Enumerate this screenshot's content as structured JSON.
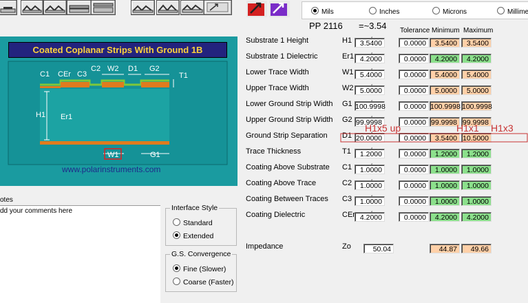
{
  "units": {
    "options": [
      {
        "label": "Mils",
        "selected": true
      },
      {
        "label": "Inches",
        "selected": false
      },
      {
        "label": "Microns",
        "selected": false
      },
      {
        "label": "Millime",
        "selected": false
      }
    ]
  },
  "diagram": {
    "title": "Coated Coplanar Strips With Ground 1B",
    "labels": {
      "c1": "C1",
      "cer": "CEr",
      "c3": "C3",
      "c2": "C2",
      "w2": "W2",
      "d1": "D1",
      "g2": "G2",
      "t1": "T1",
      "h1": "H1",
      "er1": "Er1",
      "w1": "W1",
      "g1": "G1"
    },
    "url": "www.polarinstruments.com",
    "colors": {
      "background": "#1a9ba0",
      "title_bg": "#23237e",
      "title_fg": "#ffd23c"
    }
  },
  "stack_label": "PP 2116",
  "stack_value": "=~3.54",
  "columns": {
    "tolerance": "Tolerance",
    "minimum": "Minimum",
    "maximum": "Maximum"
  },
  "params": [
    {
      "label": "Substrate 1 Height",
      "sym": "H1",
      "pm": "+/-",
      "val": "3.5400",
      "tol": "0.0000",
      "min": "3.5400",
      "max": "3.5400",
      "shade": "orange"
    },
    {
      "label": "Substrate 1 Dielectric",
      "sym": "Er1",
      "pm": "+/-",
      "val": "4.2000",
      "tol": "0.0000",
      "min": "4.2000",
      "max": "4.2000",
      "shade": "green"
    },
    {
      "label": "Lower Trace Width",
      "sym": "W1",
      "pm": "+/-",
      "val": "5.4000",
      "tol": "0.0000",
      "min": "5.4000",
      "max": "5.4000",
      "shade": "orange"
    },
    {
      "label": "Upper Trace Width",
      "sym": "W2",
      "pm": "+/-",
      "val": "5.0000",
      "tol": "0.0000",
      "min": "5.0000",
      "max": "5.0000",
      "shade": "orange"
    },
    {
      "label": "Lower Ground Strip Width",
      "sym": "G1",
      "pm": "+/-",
      "val": "100.9998",
      "tol": "0.0000",
      "min": "100.9998",
      "max": "100.9998",
      "shade": "orange"
    },
    {
      "label": "Upper Ground Strip Width",
      "sym": "G2",
      "pm": "+/-",
      "val": "99.9998",
      "tol": "0.0000",
      "min": "99.9998",
      "max": "99.9998",
      "shade": "orange"
    },
    {
      "label": "Ground Strip Separation",
      "sym": "D1",
      "pm": "+/-",
      "val": "20.0000",
      "tol": "0.0000",
      "min": "3.5400",
      "max": "10.5000",
      "shade": "orange"
    },
    {
      "label": "Trace Thickness",
      "sym": "T1",
      "pm": "+/-",
      "val": "1.2000",
      "tol": "0.0000",
      "min": "1.2000",
      "max": "1.2000",
      "shade": "green"
    },
    {
      "label": "Coating Above Substrate",
      "sym": "C1",
      "pm": "+/-",
      "val": "1.0000",
      "tol": "0.0000",
      "min": "1.0000",
      "max": "1.0000",
      "shade": "green"
    },
    {
      "label": "Coating Above Trace",
      "sym": "C2",
      "pm": "+/-",
      "val": "1.0000",
      "tol": "0.0000",
      "min": "1.0000",
      "max": "1.0000",
      "shade": "green"
    },
    {
      "label": "Coating Between Traces",
      "sym": "C3",
      "pm": "+/-",
      "val": "1.0000",
      "tol": "0.0000",
      "min": "1.0000",
      "max": "1.0000",
      "shade": "green"
    },
    {
      "label": "Coating Dielectric",
      "sym": "CEr",
      "pm": "+/-",
      "val": "4.2000",
      "tol": "0.0000",
      "min": "4.2000",
      "max": "4.2000",
      "shade": "green"
    }
  ],
  "annotations": {
    "h1x5up": "H1x5 up",
    "h1x1": "H1x1",
    "h1x3": "H1x3"
  },
  "impedance": {
    "label": "Impedance",
    "sym": "Zo",
    "val": "50.04",
    "min": "44.87",
    "max": "49.66"
  },
  "notes": {
    "label": "otes",
    "text": "dd your comments here"
  },
  "interface_style": {
    "title": "Interface Style",
    "options": [
      {
        "label": "Standard",
        "selected": false
      },
      {
        "label": "Extended",
        "selected": true
      }
    ]
  },
  "convergence": {
    "title": "G.S. Convergence",
    "options": [
      {
        "label": "Fine (Slower)",
        "selected": true
      },
      {
        "label": "Coarse (Faster)",
        "selected": false
      }
    ]
  }
}
